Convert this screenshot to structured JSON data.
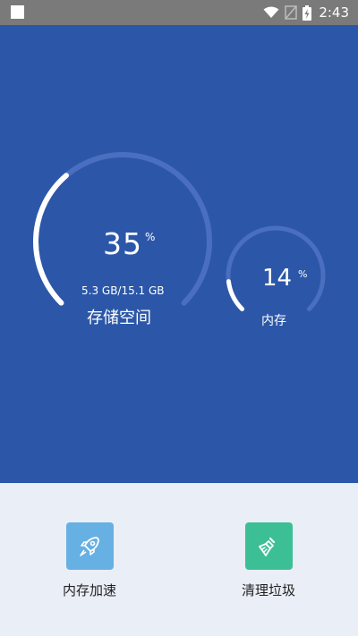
{
  "status_bar": {
    "time": "2:43",
    "icons": [
      "wifi-icon",
      "no-signal-icon",
      "battery-charging-icon"
    ]
  },
  "storage": {
    "percent": "35",
    "unit": "%",
    "size": "5.3 GB/15.1 GB",
    "label": "存储空间",
    "progress": 0.35
  },
  "memory": {
    "percent": "14",
    "unit": "%",
    "label": "内存",
    "progress": 0.14
  },
  "actions": {
    "boost": {
      "label": "内存加速",
      "icon": "rocket-icon",
      "color": "#67b0e3"
    },
    "clean": {
      "label": "清理垃圾",
      "icon": "broom-icon",
      "color": "#3dbf96"
    }
  },
  "colors": {
    "hero_background": "#2c57a8",
    "track": "#4a6fc0",
    "progress": "#ffffff",
    "panel_background": "#eaeef6"
  }
}
